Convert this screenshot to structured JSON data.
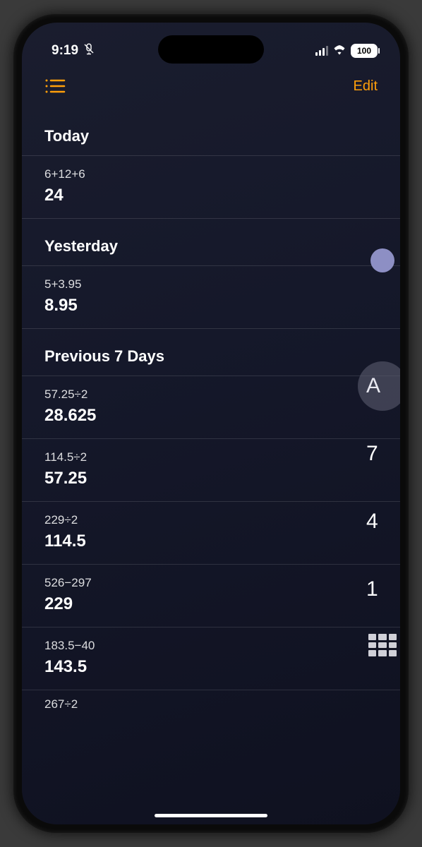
{
  "status": {
    "time": "9:19",
    "battery": "100"
  },
  "nav": {
    "edit": "Edit"
  },
  "sections": [
    {
      "title": "Today",
      "items": [
        {
          "expr": "6+12+6",
          "result": "24"
        }
      ]
    },
    {
      "title": "Yesterday",
      "items": [
        {
          "expr": "5+3.95",
          "result": "8.95"
        }
      ]
    },
    {
      "title": "Previous 7 Days",
      "items": [
        {
          "expr": "57.25÷2",
          "result": "28.625"
        },
        {
          "expr": "114.5÷2",
          "result": "57.25"
        },
        {
          "expr": "229÷2",
          "result": "114.5"
        },
        {
          "expr": "526−297",
          "result": "229"
        },
        {
          "expr": "183.5−40",
          "result": "143.5"
        }
      ]
    }
  ],
  "partial": "267÷2",
  "peek_keys": [
    "A",
    "7",
    "4",
    "1"
  ]
}
